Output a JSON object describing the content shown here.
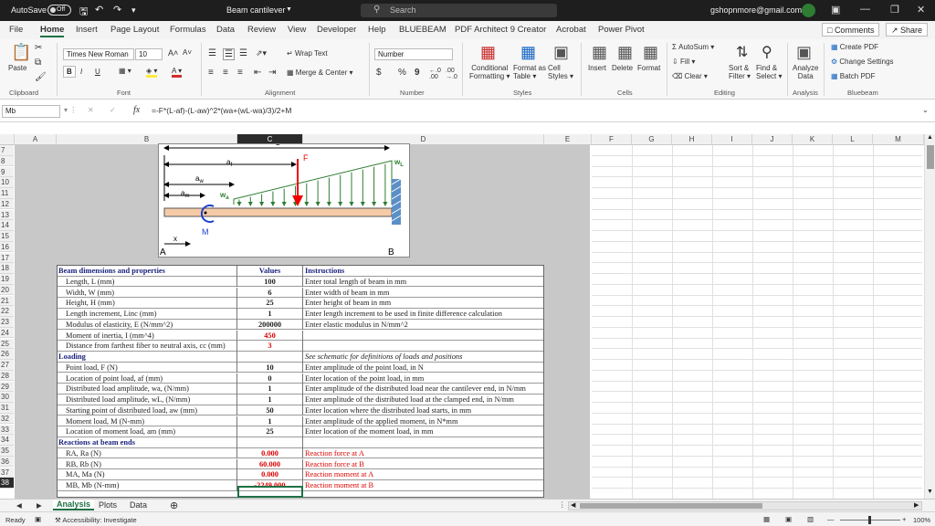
{
  "titlebar": {
    "autosave_label": "AutoSave",
    "autosave_state": "Off",
    "doc_title": "Beam cantilever",
    "search_placeholder": "Search",
    "account": "gshopnmore@gmail.com"
  },
  "tabs": [
    "File",
    "Home",
    "Insert",
    "Page Layout",
    "Formulas",
    "Data",
    "Review",
    "View",
    "Developer",
    "Help",
    "BLUEBEAM",
    "PDF Architect 9 Creator",
    "Acrobat",
    "Power Pivot"
  ],
  "top_buttons": {
    "comments": "Comments",
    "share": "Share"
  },
  "ribbon": {
    "paste": "Paste",
    "font_name": "Times New Roman",
    "font_size": "10",
    "bold": "B",
    "italic": "I",
    "underline": "U",
    "grow": "A˄",
    "shrink": "A˅",
    "wrap_text": "Wrap Text",
    "merge_center": "Merge & Center",
    "number_format": "Number",
    "currency": "$",
    "percent": "%",
    "comma": "9",
    "cond_format": "Conditional",
    "cond_format2": "Formatting",
    "format_table": "Format as",
    "format_table2": "Table",
    "cell_styles": "Cell",
    "cell_styles2": "Styles",
    "insert": "Insert",
    "delete": "Delete",
    "format": "Format",
    "autosum": "AutoSum",
    "fill": "Fill",
    "clear": "Clear",
    "sort_filter": "Sort &",
    "sort_filter2": "Filter",
    "find_select": "Find &",
    "find_select2": "Select",
    "analyze": "Analyze",
    "analyze2": "Data",
    "create_pdf": "Create PDF",
    "change_settings": "Change Settings",
    "batch_pdf": "Batch PDF",
    "groups": [
      "Clipboard",
      "Font",
      "Alignment",
      "Number",
      "Styles",
      "Cells",
      "Editing",
      "Analysis",
      "Bluebeam"
    ]
  },
  "formula_bar": {
    "name_box": "Mb",
    "fx": "fx",
    "formula": "=-F*(L-af)-(L-aw)^2*(wa+(wL-wa)/3)/2+M"
  },
  "columns": [
    "A",
    "B",
    "C",
    "D",
    "E",
    "F",
    "G",
    "H",
    "I",
    "J",
    "K",
    "L",
    "M"
  ],
  "rows": [
    "7",
    "8",
    "9",
    "10",
    "11",
    "12",
    "13",
    "14",
    "15",
    "16",
    "17",
    "18",
    "19",
    "20",
    "21",
    "22",
    "23",
    "24",
    "25",
    "26",
    "27",
    "28",
    "29",
    "30",
    "31",
    "32",
    "33",
    "34",
    "35",
    "36",
    "37",
    "38"
  ],
  "diagram": {
    "L": "L",
    "af": "a",
    "af_sub": "f",
    "aw": "a",
    "aw_sub": "w",
    "am": "a",
    "am_sub": "m",
    "F": "F",
    "wa": "w",
    "wa_sub": "a",
    "wL": "w",
    "wL_sub": "L",
    "M": "M",
    "x": "x",
    "A": "A",
    "B": "B"
  },
  "table": [
    {
      "type": "header",
      "c1": "Beam dimensions and properties",
      "c2": "Values",
      "c3": "Instructions"
    },
    {
      "c1": "Length, L (mm)",
      "c2": "100",
      "c3": "Enter total length of beam in mm"
    },
    {
      "c1": "Width, W (mm)",
      "c2": "6",
      "c3": "Enter width of beam in mm"
    },
    {
      "c1": "Height, H (mm)",
      "c2": "25",
      "c3": "Enter height of beam in mm"
    },
    {
      "c1": "Length increment, Linc (mm)",
      "c2": "1",
      "c3": "Enter length increment to be used in finite difference calculation"
    },
    {
      "c1": "Modulus of elasticity, E (N/mm^2)",
      "c2": "200000",
      "c3": "Enter elastic modulus in N/mm^2"
    },
    {
      "c1": "Moment of inertia, I (mm^4)",
      "c2": "450",
      "c3": "",
      "red2": true
    },
    {
      "c1": "Distance from farthest fiber to neutral axis, cc (mm)",
      "c2": "3",
      "c3": "",
      "red2": true
    },
    {
      "type": "header",
      "c1": "Loading",
      "c2": "",
      "c3": "See schematic for definitions of loads and positions",
      "ital3": true
    },
    {
      "c1": "Point load, F (N)",
      "c2": "10",
      "c3": "Enter amplitude of the point load, in N"
    },
    {
      "c1": "Location of point load, af (mm)",
      "c2": "0",
      "c3": "Enter location of the point load, in mm"
    },
    {
      "c1": "Distributed load amplitude, wa, (N/mm)",
      "c2": "1",
      "c3": "Enter amplitude of the distributed load near the cantilever end, in N/mm"
    },
    {
      "c1": "Distributed load amplitude, wL, (N/mm)",
      "c2": "1",
      "c3": "Enter amplitude of the distributed load at the clamped end, in N/mm"
    },
    {
      "c1": "Starting point of distributed load, aw (mm)",
      "c2": "50",
      "c3": "Enter location where the distributed load starts, in mm"
    },
    {
      "c1": "Moment load, M (N-mm)",
      "c2": "1",
      "c3": "Enter amplitude of the applied moment, in N*mm"
    },
    {
      "c1": "Location of moment load, am (mm)",
      "c2": "25",
      "c3": "Enter location of the moment load, in mm"
    },
    {
      "type": "header",
      "c1": "Reactions at beam ends",
      "c2": "",
      "c3": ""
    },
    {
      "c1": "RA, Ra (N)",
      "c2": "0.000",
      "c3": "Reaction force at A",
      "red2": true,
      "red3": true
    },
    {
      "c1": "RB, Rb (N)",
      "c2": "60.000",
      "c3": "Reaction force at B",
      "red2": true,
      "red3": true
    },
    {
      "c1": "MA, Ma (N)",
      "c2": "0.000",
      "c3": "Reaction moment at A",
      "red2": true,
      "red3": true
    },
    {
      "c1": "MB, Mb (N-mm)",
      "c2": "-2249.000",
      "c3": "Reaction moment at B",
      "red2": true,
      "red3": true
    }
  ],
  "sheets": [
    "Analysis",
    "Plots",
    "Data"
  ],
  "status": {
    "ready": "Ready",
    "accessibility": "Accessibility: Investigate",
    "zoom": "100%"
  }
}
